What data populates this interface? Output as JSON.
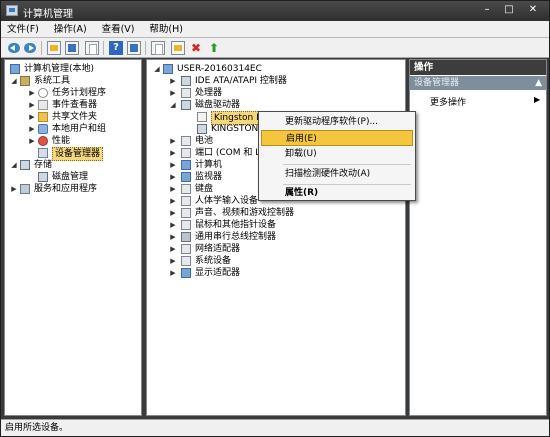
{
  "window": {
    "title": "计算机管理",
    "min": "–",
    "max": "□",
    "close": "✕"
  },
  "menubar": {
    "items": [
      "文件(F)",
      "操作(A)",
      "查看(V)",
      "帮助(H)"
    ]
  },
  "left_tree": {
    "root": "计算机管理(本地)",
    "system_tools": "系统工具",
    "task_scheduler": "任务计划程序",
    "event_viewer": "事件查看器",
    "shared_folders": "共享文件夹",
    "local_users": "本地用户和组",
    "performance": "性能",
    "device_manager": "设备管理器",
    "storage": "存储",
    "disk_management": "磁盘管理",
    "services": "服务和应用程序"
  },
  "device_tree": {
    "computer_name": "USER-20160314EC",
    "ide": "IDE ATA/ATAPI 控制器",
    "processors": "处理器",
    "disk_drives": "磁盘驱动器",
    "kingston1": "Kingston DT",
    "kingston2": "KINGSTON KIN",
    "battery": "电池",
    "ports": "端口 (COM 和 LP",
    "computer": "计算机",
    "monitors": "监视器",
    "keyboards": "键盘",
    "hid": "人体学输入设备",
    "sound": "声音、视频和游戏控制器",
    "mice": "鼠标和其他指针设备",
    "usb": "通用串行总线控制器",
    "network": "网络适配器",
    "system": "系统设备",
    "display": "显示适配器"
  },
  "context_menu": {
    "update_driver": "更新驱动程序软件(P)...",
    "enable": "启用(E)",
    "uninstall": "卸载(U)",
    "scan": "扫描检测硬件改动(A)",
    "properties": "属性(R)"
  },
  "actions_panel": {
    "header": "操作",
    "section": "设备管理器",
    "more": "更多操作"
  },
  "statusbar": {
    "text": "启用所选设备。"
  }
}
